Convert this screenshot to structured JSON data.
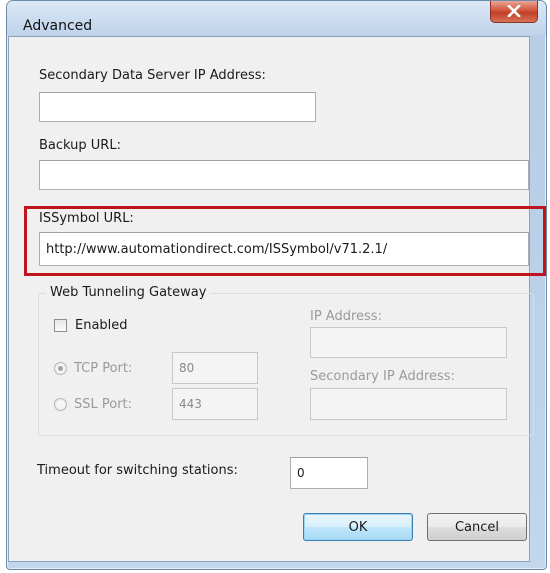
{
  "window": {
    "title": "Advanced"
  },
  "fields": {
    "secondary_ip": {
      "label": "Secondary Data Server IP Address:",
      "value": ""
    },
    "backup_url": {
      "label": "Backup URL:",
      "value": ""
    },
    "issymbol_url": {
      "label": "ISSymbol URL:",
      "value": "http://www.automationdirect.com/ISSymbol/v71.2.1/"
    }
  },
  "gateway": {
    "legend": "Web Tunneling Gateway",
    "enabled_label": "Enabled",
    "enabled_checked": false,
    "tcp_label": "TCP Port:",
    "tcp_value": "80",
    "ssl_label": "SSL Port:",
    "ssl_value": "443",
    "ip_label": "IP Address:",
    "ip_value": "",
    "secondary_ip_label": "Secondary IP Address:",
    "secondary_ip_value": ""
  },
  "timeout": {
    "label": "Timeout for switching stations:",
    "value": "0"
  },
  "buttons": {
    "ok": "OK",
    "cancel": "Cancel"
  },
  "colors": {
    "highlight": "#c0141c",
    "close_button": "#c94a33",
    "title_bar": "#c6d9ee"
  }
}
